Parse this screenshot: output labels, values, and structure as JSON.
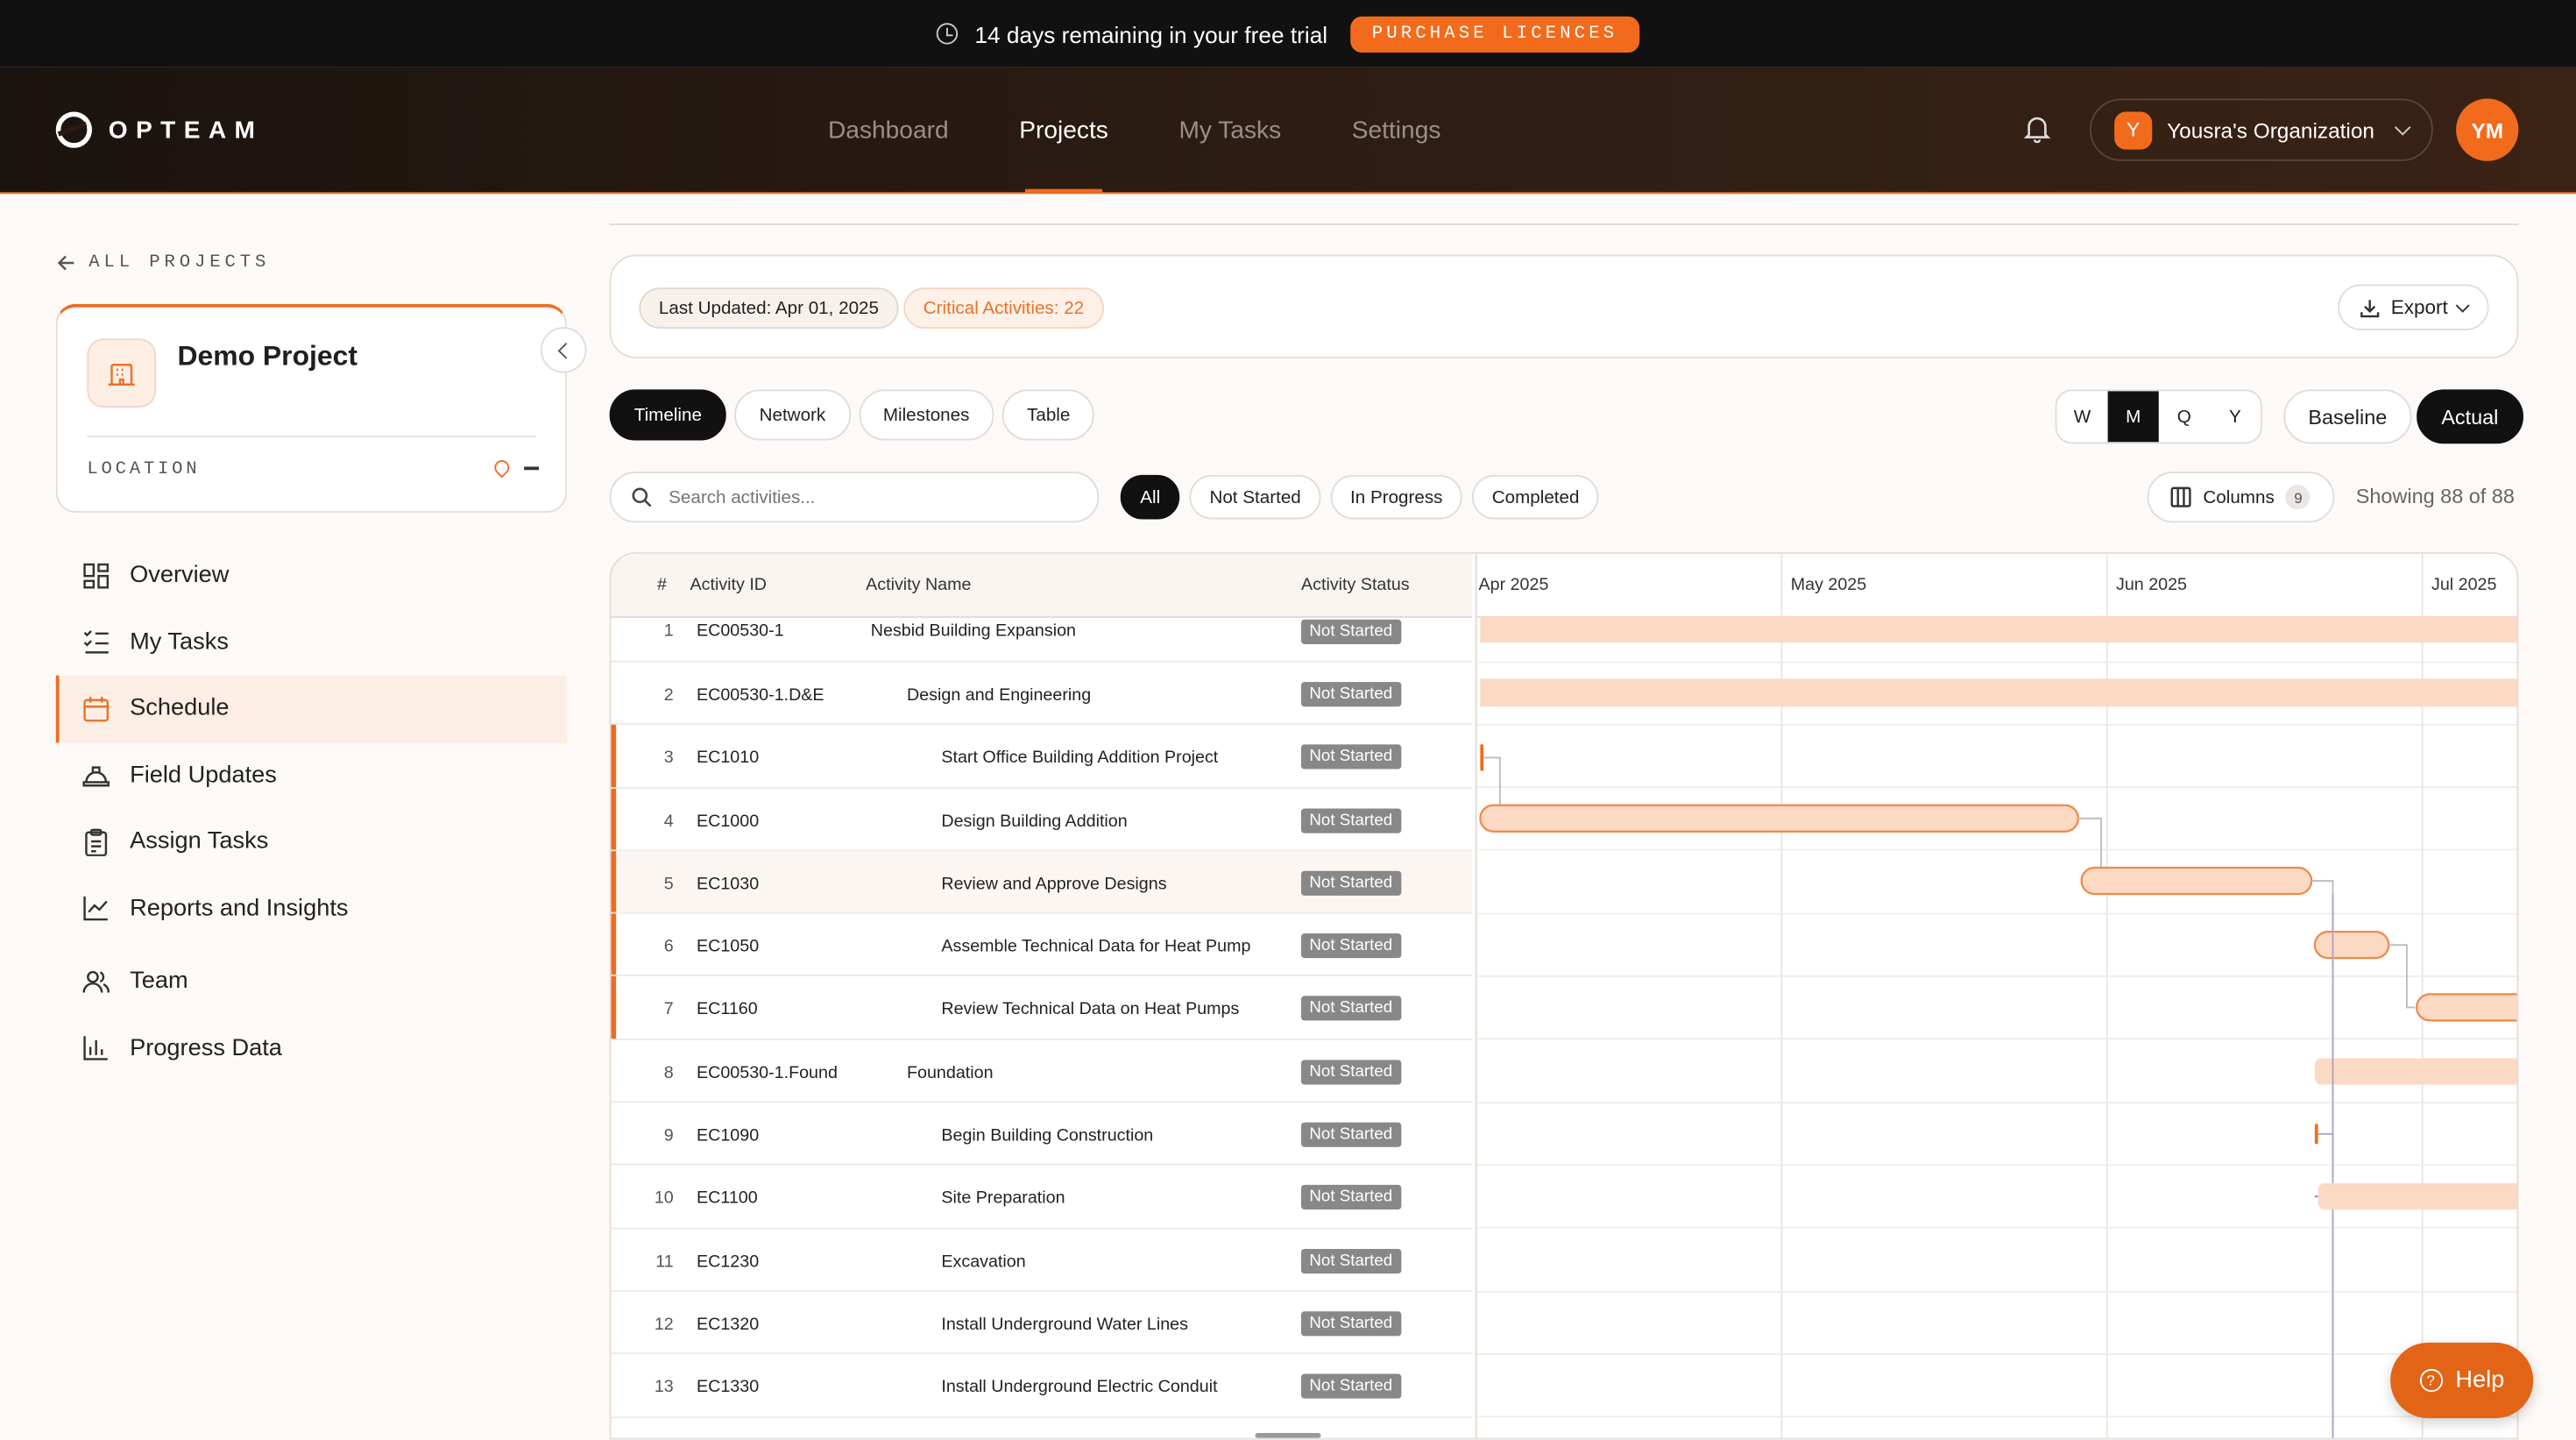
{
  "banner": {
    "message": "14 days remaining in your free trial",
    "cta": "PURCHASE LICENCES"
  },
  "header": {
    "logo": "OPTEAM",
    "nav": [
      "Dashboard",
      "Projects",
      "My Tasks",
      "Settings"
    ],
    "active_nav": "Projects",
    "org_initial": "Y",
    "org_name": "Yousra's Organization",
    "user_initials": "YM"
  },
  "sidebar": {
    "back_label": "ALL PROJECTS",
    "project_name": "Demo Project",
    "location_label": "LOCATION",
    "items": [
      {
        "label": "Overview",
        "icon": "grid-icon"
      },
      {
        "label": "My Tasks",
        "icon": "checklist-icon"
      },
      {
        "label": "Schedule",
        "icon": "calendar-icon",
        "active": true
      },
      {
        "label": "Field Updates",
        "icon": "hardhat-icon"
      },
      {
        "label": "Assign Tasks",
        "icon": "clipboard-icon"
      },
      {
        "label": "Reports and Insights",
        "icon": "line-chart-icon"
      },
      {
        "label": "Team",
        "icon": "users-icon"
      },
      {
        "label": "Progress Data",
        "icon": "bar-chart-icon"
      }
    ]
  },
  "info": {
    "last_updated": "Last Updated: Apr 01, 2025",
    "critical": "Critical Activities: 22",
    "export_label": "Export"
  },
  "view_tabs": [
    "Timeline",
    "Network",
    "Milestones",
    "Table"
  ],
  "active_view": "Timeline",
  "scales": [
    "W",
    "M",
    "Q",
    "Y"
  ],
  "active_scale": "M",
  "baseline_label": "Baseline",
  "actual_label": "Actual",
  "search_placeholder": "Search activities...",
  "filters": [
    "All",
    "Not Started",
    "In Progress",
    "Completed"
  ],
  "active_filter": "All",
  "columns_label": "Columns",
  "columns_count": "9",
  "showing": "Showing 88 of 88",
  "table": {
    "headers": {
      "num": "#",
      "id": "Activity ID",
      "name": "Activity Name",
      "status": "Activity Status"
    },
    "rows": [
      {
        "num": "1",
        "id": "EC00530-1",
        "name": "Nesbid Building Expansion",
        "status": "Not Started",
        "level": 0
      },
      {
        "num": "2",
        "id": "EC00530-1.D&E",
        "name": "Design and Engineering",
        "status": "Not Started",
        "level": 1
      },
      {
        "num": "3",
        "id": "EC1010",
        "name": "Start Office Building Addition Project",
        "status": "Not Started",
        "level": 2,
        "critical": true
      },
      {
        "num": "4",
        "id": "EC1000",
        "name": "Design Building Addition",
        "status": "Not Started",
        "level": 2,
        "critical": true
      },
      {
        "num": "5",
        "id": "EC1030",
        "name": "Review and Approve Designs",
        "status": "Not Started",
        "level": 2,
        "critical": true,
        "highlight": true
      },
      {
        "num": "6",
        "id": "EC1050",
        "name": "Assemble Technical Data for Heat Pump",
        "status": "Not Started",
        "level": 2,
        "critical": true
      },
      {
        "num": "7",
        "id": "EC1160",
        "name": "Review Technical Data on Heat Pumps",
        "status": "Not Started",
        "level": 2,
        "critical": true
      },
      {
        "num": "8",
        "id": "EC00530-1.Found",
        "name": "Foundation",
        "status": "Not Started",
        "level": 1
      },
      {
        "num": "9",
        "id": "EC1090",
        "name": "Begin Building Construction",
        "status": "Not Started",
        "level": 2
      },
      {
        "num": "10",
        "id": "EC1100",
        "name": "Site Preparation",
        "status": "Not Started",
        "level": 2
      },
      {
        "num": "11",
        "id": "EC1230",
        "name": "Excavation",
        "status": "Not Started",
        "level": 2
      },
      {
        "num": "12",
        "id": "EC1320",
        "name": "Install Underground Water Lines",
        "status": "Not Started",
        "level": 2
      },
      {
        "num": "13",
        "id": "EC1330",
        "name": "Install Underground Electric Conduit",
        "status": "Not Started",
        "level": 2
      }
    ]
  },
  "gantt": {
    "months": [
      "Apr 2025",
      "May 2025",
      "Jun 2025",
      "Jul 2025"
    ]
  },
  "help_label": "Help",
  "colors": {
    "accent": "#f26b1d",
    "bar_fill": "#fcd9c3",
    "status_bg": "#888888"
  }
}
